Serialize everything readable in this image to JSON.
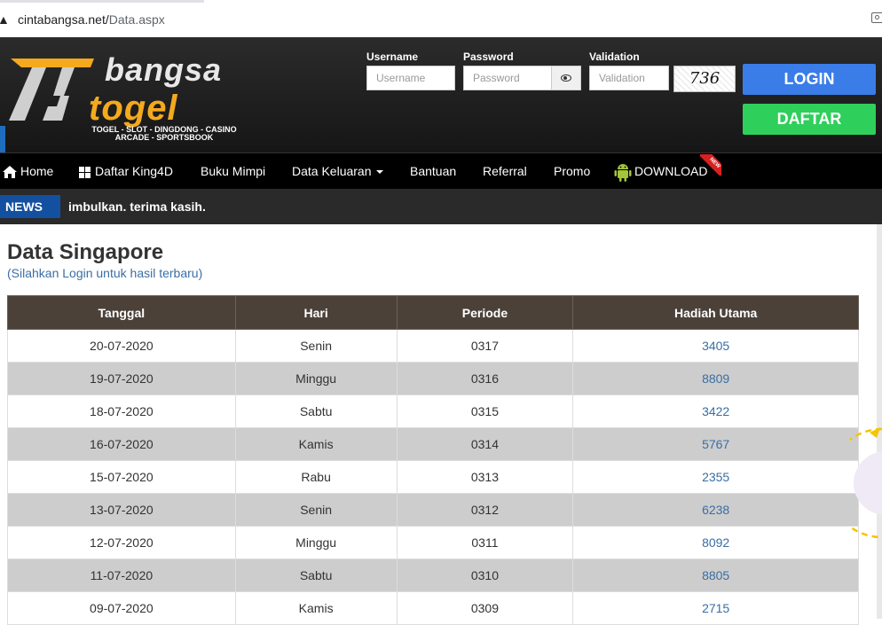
{
  "browser": {
    "url_host": "cintabangsa.net/",
    "url_path": "Data.aspx"
  },
  "brand": {
    "word1": "bangsa",
    "word2": "togel",
    "tagline_line1": "TOGEL - SLOT - DINGDONG - CASINO",
    "tagline_line2": "ARCADE - SPORTSBOOK",
    "accent": "#f4a91e"
  },
  "login": {
    "username_label": "Username",
    "username_placeholder": "Username",
    "password_label": "Password",
    "password_placeholder": "Password",
    "validation_label": "Validation",
    "validation_placeholder": "Validation",
    "captcha_text": "736",
    "login_button": "LOGIN",
    "daftar_button": "DAFTAR"
  },
  "nav": {
    "items": [
      {
        "label": "Home",
        "icon": "home-icon"
      },
      {
        "label": "Daftar King4D",
        "icon": "grid-icon"
      },
      {
        "label": "Buku Mimpi"
      },
      {
        "label": "Data Keluaran",
        "dropdown": true
      },
      {
        "label": "Bantuan"
      },
      {
        "label": "Referral"
      },
      {
        "label": "Promo"
      },
      {
        "label": "DOWNLOAD",
        "icon": "android-icon",
        "badge": "NEW"
      }
    ]
  },
  "news": {
    "label": "NEWS",
    "text": "imbulkan. terima kasih."
  },
  "main": {
    "title": "Data Singapore",
    "subtitle": "(Silahkan Login untuk hasil terbaru)",
    "table": {
      "headers": [
        "Tanggal",
        "Hari",
        "Periode",
        "Hadiah Utama"
      ],
      "rows": [
        [
          "20-07-2020",
          "Senin",
          "0317",
          "3405"
        ],
        [
          "19-07-2020",
          "Minggu",
          "0316",
          "8809"
        ],
        [
          "18-07-2020",
          "Sabtu",
          "0315",
          "3422"
        ],
        [
          "16-07-2020",
          "Kamis",
          "0314",
          "5767"
        ],
        [
          "15-07-2020",
          "Rabu",
          "0313",
          "2355"
        ],
        [
          "13-07-2020",
          "Senin",
          "0312",
          "6238"
        ],
        [
          "12-07-2020",
          "Minggu",
          "0311",
          "8092"
        ],
        [
          "11-07-2020",
          "Sabtu",
          "0310",
          "8805"
        ],
        [
          "09-07-2020",
          "Kamis",
          "0309",
          "2715"
        ]
      ]
    }
  }
}
